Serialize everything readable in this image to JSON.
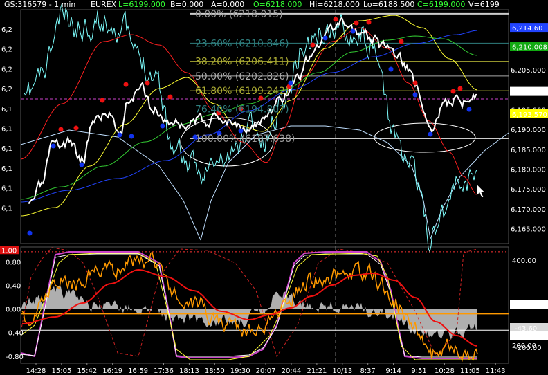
{
  "header": {
    "symbol_interval": "GS:316579 - 1 min",
    "exchange": "EUREX",
    "last": "L=6199.000",
    "bid": "B=0.000",
    "ask": "A=0.000",
    "open": "O=6218.000",
    "high": "Hi=6218.000",
    "low": "Lo=6188.500",
    "close": "C=6199.000",
    "volume": "V=6199"
  },
  "colors": {
    "background": "#000000",
    "price": "#ffffff",
    "cyan": "#7fffff",
    "red": "#ff2020",
    "yellow": "#ffff33",
    "green": "#33cc33",
    "blue": "#2244ff",
    "fib_teal": "#2f7f7f",
    "fib_olive": "#aaaa33",
    "gray": "#b8b8b8",
    "orange": "#ff9900",
    "magenta": "#cc44cc"
  },
  "chart_data": [
    {
      "type": "line",
      "panel": "price",
      "x_tick_labels": [
        "14:28",
        "15:05",
        "15:42",
        "16:19",
        "16:59",
        "17:36",
        "18:13",
        "18:50",
        "19:30",
        "20:07",
        "20:44",
        "21:21",
        "10/13",
        "8:37",
        "9:14",
        "9:51",
        "10:28",
        "11:05",
        "11:43"
      ],
      "y_axis_right": [
        "6,205.000",
        "6,200.000",
        "6,195.000",
        "6,190.000",
        "6,185.000",
        "6,180.000",
        "6,175.000",
        "6,170.000",
        "6,165.000"
      ],
      "y_axis_left": [
        "6,2",
        "6,2",
        "6,2",
        "6,2",
        "6,1",
        "6,1",
        "6,1",
        "6,1",
        "6,1",
        "6,1"
      ],
      "price_tags": [
        {
          "text": "6,214.60",
          "bg": "#2244ff",
          "fg": "#ffffff",
          "value": 6214.6
        },
        {
          "text": "6,210.008",
          "bg": "#11aa11",
          "fg": "#ffffff",
          "value": 6210.0
        },
        {
          "text": "6,199.000",
          "bg": "#ffffff",
          "fg": "#000000",
          "value": 6199.0
        },
        {
          "text": "6,193.570",
          "bg": "#ffff00",
          "fg": "#000000",
          "value": 6193.57
        }
      ],
      "fib_levels": [
        {
          "label": "0.00% (6218.015)",
          "value": 6218.015,
          "color": "#999999"
        },
        {
          "label": "23.60% (6210.846)",
          "value": 6210.846,
          "color": "#2f7f7f"
        },
        {
          "label": "38.20% (6206.411)",
          "value": 6206.411,
          "color": "#aaaa33"
        },
        {
          "label": "50.00% (6202.826)",
          "value": 6202.826,
          "color": "#aaaaaa"
        },
        {
          "label": "61.80% (6199.242)",
          "value": 6199.242,
          "color": "#aaaa33"
        },
        {
          "label": "76.40% (6194.807)",
          "value": 6194.807,
          "color": "#2f7f7f"
        },
        {
          "label": "100.00% (6187.638)",
          "value": 6187.638,
          "color": "#999999"
        }
      ],
      "ylim": [
        6162,
        6219
      ]
    },
    {
      "type": "line",
      "panel": "oscillator",
      "y_axis_left": [
        "1.00",
        "0.80",
        "0.40",
        "0.00",
        "-0.40",
        "-0.80"
      ],
      "y_axis_right": [
        "400.00",
        "200.00",
        "110.00",
        "-43.60",
        "-110.00",
        "-200.00"
      ],
      "value_tags": [
        {
          "text": "110.00",
          "bg": "#ffffff",
          "fg": "#000000"
        },
        {
          "text": "-43.60",
          "bg": "#d8d8d8",
          "fg": "#000000"
        },
        {
          "text": "-110.00",
          "bg": "#ffffff",
          "fg": "#000000"
        }
      ],
      "ylim": [
        -0.92,
        1.05
      ]
    }
  ]
}
